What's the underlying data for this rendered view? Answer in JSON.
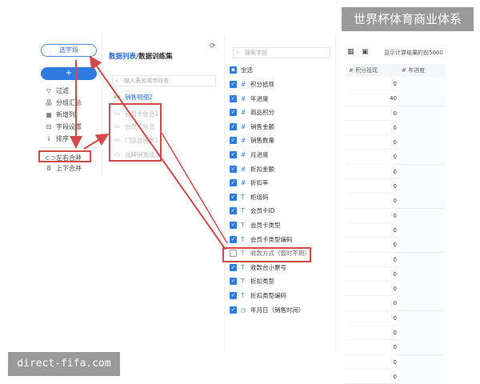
{
  "watermark_top": "世界杯体育商业体系",
  "watermark_bottom": "direct-fifa.com",
  "left_panel": {
    "select_field_label": "选字段",
    "add_button_label": "+",
    "menu": [
      {
        "icon": "filter-icon",
        "glyph": "▽",
        "label": "过滤"
      },
      {
        "icon": "group-summary-icon",
        "glyph": "品",
        "label": "分组汇总"
      },
      {
        "icon": "new-column-icon",
        "glyph": "▦",
        "label": "新增列"
      },
      {
        "icon": "field-settings-icon",
        "glyph": "⊡",
        "label": "字段设置"
      },
      {
        "icon": "sort-icon",
        "glyph": "⇂",
        "label": "排序"
      },
      {
        "icon": "left-right-merge-icon",
        "glyph": "⊂⊃",
        "label": "左右合并"
      },
      {
        "icon": "up-down-merge-icon",
        "glyph": "8",
        "label": "上下合并"
      }
    ]
  },
  "middle_panel": {
    "breadcrumb_link": "数据列表",
    "breadcrumb_sep": "/",
    "breadcrumb_current": "数据训练集",
    "search_placeholder": "输入表名或字段名",
    "tables": [
      {
        "label": "销售明细2",
        "tag": "xls"
      },
      {
        "label": "会员卡信息1",
        "tag": "xls"
      },
      {
        "label": "会员卡信息",
        "tag": "xls"
      },
      {
        "label": "门店品牌表1",
        "tag": "xls"
      },
      {
        "label": "品牌销售成本",
        "tag": "xls"
      }
    ]
  },
  "fields_panel": {
    "search_placeholder": "搜索字段",
    "select_all_label": "全选",
    "fields": [
      {
        "type": "#",
        "name": "积分抵现",
        "checked": true
      },
      {
        "type": "#",
        "name": "年进度",
        "checked": true
      },
      {
        "type": "#",
        "name": "商品积分",
        "checked": true
      },
      {
        "type": "#",
        "name": "销售金额",
        "checked": true
      },
      {
        "type": "#",
        "name": "销售数量",
        "checked": true
      },
      {
        "type": "#",
        "name": "月进度",
        "checked": true
      },
      {
        "type": "#",
        "name": "折扣金额",
        "checked": true
      },
      {
        "type": "#",
        "name": "折扣率",
        "checked": true
      },
      {
        "type": "T",
        "name": "柜组码",
        "checked": true
      },
      {
        "type": "T",
        "name": "会员卡ID",
        "checked": true
      },
      {
        "type": "T",
        "name": "会员卡类型",
        "checked": true
      },
      {
        "type": "T",
        "name": "会员卡类型编码",
        "checked": true
      },
      {
        "type": "T",
        "name": "收款方式（暂时不用）",
        "checked": false
      },
      {
        "type": "T",
        "name": "收款台小票号",
        "checked": true
      },
      {
        "type": "T",
        "name": "折扣类型",
        "checked": true
      },
      {
        "type": "T",
        "name": "折扣类型编码",
        "checked": true
      },
      {
        "type": "◷",
        "name": "年月日（销售时间）",
        "checked": true
      }
    ]
  },
  "preview_panel": {
    "note": "显示计算结果的前5000",
    "columns": [
      "#  积分抵现",
      "#  年进度"
    ],
    "values": [
      "0",
      "40",
      "0",
      "0",
      "0",
      "0",
      "0",
      "0",
      "0",
      "0",
      "0",
      "0",
      "0",
      "0",
      "0",
      "0",
      "0",
      "0",
      "0",
      "0",
      "0",
      "0"
    ]
  },
  "colors": {
    "accent": "#2f7be0",
    "highlight": "#d44a4a"
  }
}
